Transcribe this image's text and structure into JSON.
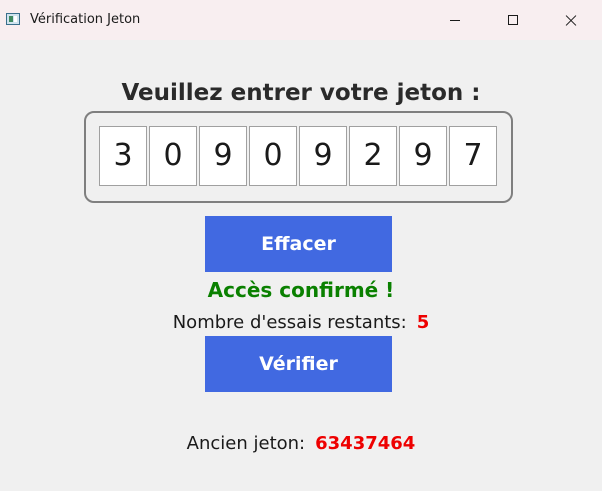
{
  "window": {
    "title": "Vérification Jeton",
    "icon": "app-icon",
    "controls": [
      "minimize-icon",
      "maximize-icon",
      "close-icon"
    ]
  },
  "main": {
    "heading": "Veuillez entrer votre jeton :",
    "digits": [
      "3",
      "0",
      "9",
      "0",
      "9",
      "2",
      "9",
      "7"
    ],
    "clear_label": "Effacer",
    "status_message": "Accès confirmé !",
    "tries_label": "Nombre d'essais restants:",
    "tries_value": "5",
    "verify_label": "Vérifier",
    "old_token_label": "Ancien jeton:",
    "old_token_value": "63437464"
  },
  "colors": {
    "button_bg": "#4169e1",
    "success": "#0a8000",
    "highlight": "#ee0000"
  }
}
